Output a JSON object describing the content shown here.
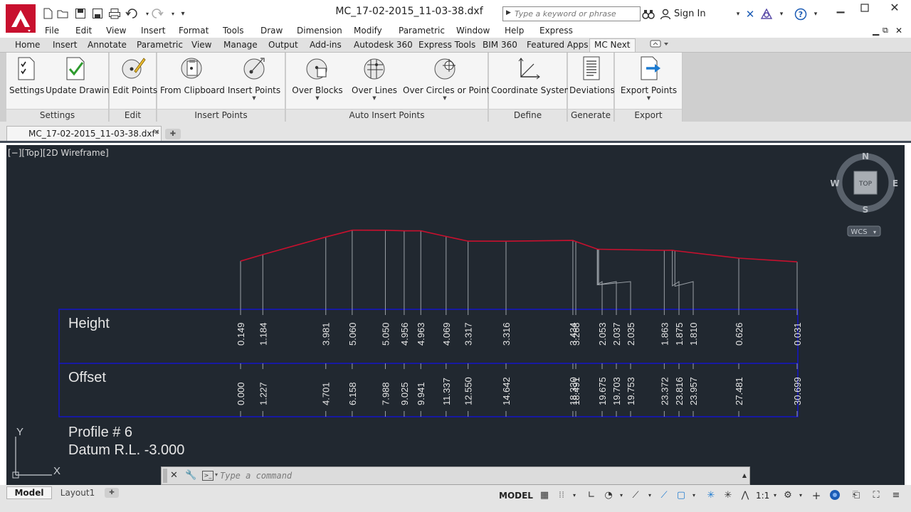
{
  "window": {
    "file_title": "MC_17-02-2015_11-03-38.dxf",
    "search_placeholder": "Type a keyword or phrase",
    "sign_in": "Sign In",
    "help": "?"
  },
  "menu": [
    "File",
    "Edit",
    "View",
    "Insert",
    "Format",
    "Tools",
    "Draw",
    "Dimension",
    "Modify",
    "Parametric",
    "Window",
    "Help",
    "Express"
  ],
  "ribbon_tabs": [
    "Home",
    "Insert",
    "Annotate",
    "Parametric",
    "View",
    "Manage",
    "Output",
    "Add-ins",
    "Autodesk 360",
    "Express Tools",
    "BIM 360",
    "Featured Apps",
    "MC Next"
  ],
  "active_ribbon_tab": "MC Next",
  "ribbon": {
    "panels": {
      "settings": "Settings",
      "edit": "Edit",
      "insert_points": "Insert Points",
      "auto_insert_points": "Auto Insert Points",
      "define": "Define",
      "generate": "Generate",
      "export": "Export"
    },
    "buttons": {
      "settings": "Settings",
      "update_drawing": "Update Drawing",
      "edit_points": "Edit Points",
      "from_clipboard": "From Clipboard",
      "insert_points": "Insert Points",
      "over_blocks": "Over Blocks",
      "over_lines": "Over Lines",
      "over_circles": "Over Circles or Points",
      "coordinate_system": "Coordinate System",
      "deviations": "Deviations",
      "export_points": "Export Points"
    }
  },
  "document_tab": "MC_17-02-2015_11-03-38.dxf*",
  "viewport_label": "[−][Top][2D Wireframe]",
  "viewcube": {
    "north": "N",
    "south": "S",
    "east": "E",
    "west": "W",
    "face": "TOP",
    "ucs": "WCS"
  },
  "ucs_axis": {
    "y": "Y",
    "x": "X"
  },
  "profile": {
    "height_label": "Height",
    "offset_label": "Offset",
    "title": "Profile # 6",
    "datum": "Datum R.L. -3.000"
  },
  "chart_data": {
    "type": "line",
    "title": "Profile # 6",
    "subtitle": "Datum R.L. -3.000",
    "xlabel": "Offset",
    "ylabel": "Height",
    "datum": -3.0,
    "offset": [
      "0.000",
      "1.227",
      "4.701",
      "6.158",
      "7.988",
      "9.025",
      "9.941",
      "11.337",
      "12.550",
      "14.642",
      "18.330",
      "18.491",
      "19.675",
      "19.703",
      "19.753",
      "23.372",
      "23.816",
      "23.957",
      "27.481",
      "30.699"
    ],
    "height": [
      "0.149",
      "1.184",
      "3.981",
      "5.060",
      "5.050",
      "4.956",
      "4.963",
      "4.069",
      "3.317",
      "3.316",
      "3.434",
      "3.268",
      "2.053",
      "2.037",
      "2.035",
      "1.863",
      "1.875",
      "1.810",
      "0.626",
      "0.031"
    ],
    "series": [
      {
        "name": "",
        "color": "#c8102e",
        "x": [
          0.0,
          1.227,
          4.701,
          6.158,
          7.988,
          9.025,
          9.941,
          11.337,
          12.55,
          14.642,
          18.33,
          18.491,
          19.675,
          19.703,
          19.753,
          23.372,
          23.816,
          23.957,
          27.481,
          30.699
        ],
        "y": [
          0.149,
          1.184,
          3.981,
          5.06,
          5.05,
          4.956,
          4.963,
          4.069,
          3.317,
          3.316,
          3.434,
          3.268,
          2.053,
          2.037,
          2.035,
          1.863,
          1.875,
          1.81,
          0.626,
          0.031
        ]
      }
    ],
    "grid": false,
    "legend": "none"
  },
  "command_line": {
    "placeholder": "Type a command"
  },
  "status": {
    "model_tab": "Model",
    "layout_tab": "Layout1",
    "space": "MODEL",
    "scale": "1:1"
  },
  "colors": {
    "canvas": "#212830",
    "profile_line": "#c8102e",
    "frame": "#1414c8",
    "app_red": "#c8102e"
  }
}
